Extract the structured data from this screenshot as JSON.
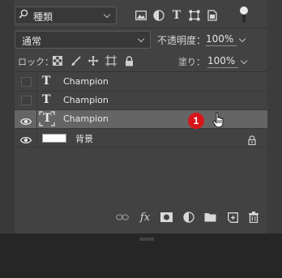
{
  "filter": {
    "kind_label": "種類",
    "icons": [
      "image-filter-icon",
      "adjustment-filter-icon",
      "type-filter-icon",
      "shape-filter-icon",
      "smart-object-filter-icon"
    ],
    "text_glyph": "T"
  },
  "blend": {
    "mode": "通常",
    "opacity_label": "不透明度：",
    "opacity_value": "100%"
  },
  "lock": {
    "label": "ロック：",
    "fill_label": "塗り：",
    "fill_value": "100%"
  },
  "layers": [
    {
      "name": "Champion",
      "type": "text",
      "visible": false,
      "selected": false
    },
    {
      "name": "Champion",
      "type": "text",
      "visible": false,
      "selected": false
    },
    {
      "name": "Champion",
      "type": "text",
      "visible": true,
      "selected": true
    },
    {
      "name": "背景",
      "type": "background",
      "visible": true,
      "selected": false,
      "locked": true
    }
  ],
  "annotation": {
    "marker_number": "1",
    "marker_color": "#d7161c"
  },
  "bottom_toolbar": {
    "fx_label": "fx",
    "icons": [
      "link-icon",
      "fx-icon",
      "mask-icon",
      "adjustment-icon",
      "folder-icon",
      "new-layer-icon",
      "trash-icon"
    ]
  },
  "colors": {
    "panel_bg": "#424242",
    "selected_row": "#656565",
    "page_bg": "#262626"
  }
}
